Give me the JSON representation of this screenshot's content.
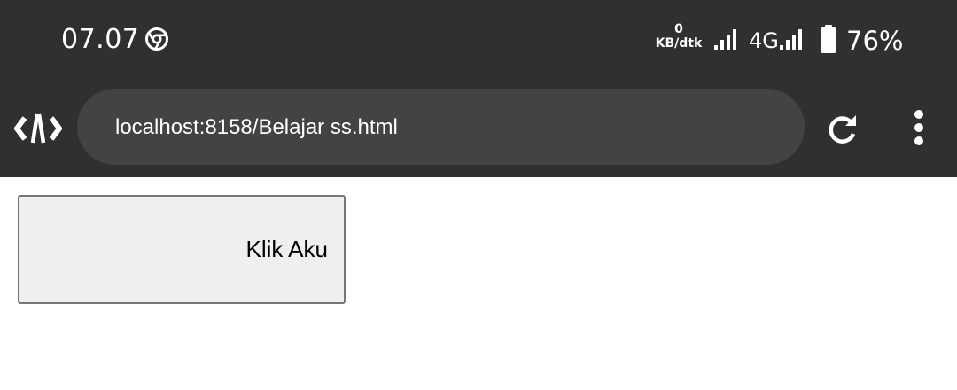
{
  "status_bar": {
    "time": "07.07",
    "net_speed_value": "0",
    "net_speed_unit": "KB/dtk",
    "network_type": "4G",
    "battery_percent": "76%",
    "battery_level": 0.76,
    "icons": [
      "chrome-icon",
      "signal-icon",
      "signal-icon",
      "battery-icon"
    ]
  },
  "toolbar": {
    "url": "localhost:8158/Belajar ss.html",
    "icons": [
      "devtools-icon",
      "reload-icon",
      "more-vert-icon"
    ]
  },
  "page": {
    "button_label": "Klik Aku"
  },
  "colors": {
    "chrome_bar": "#303030",
    "url_bar": "#434343",
    "button_bg": "#efefef",
    "button_border": "#767676"
  }
}
